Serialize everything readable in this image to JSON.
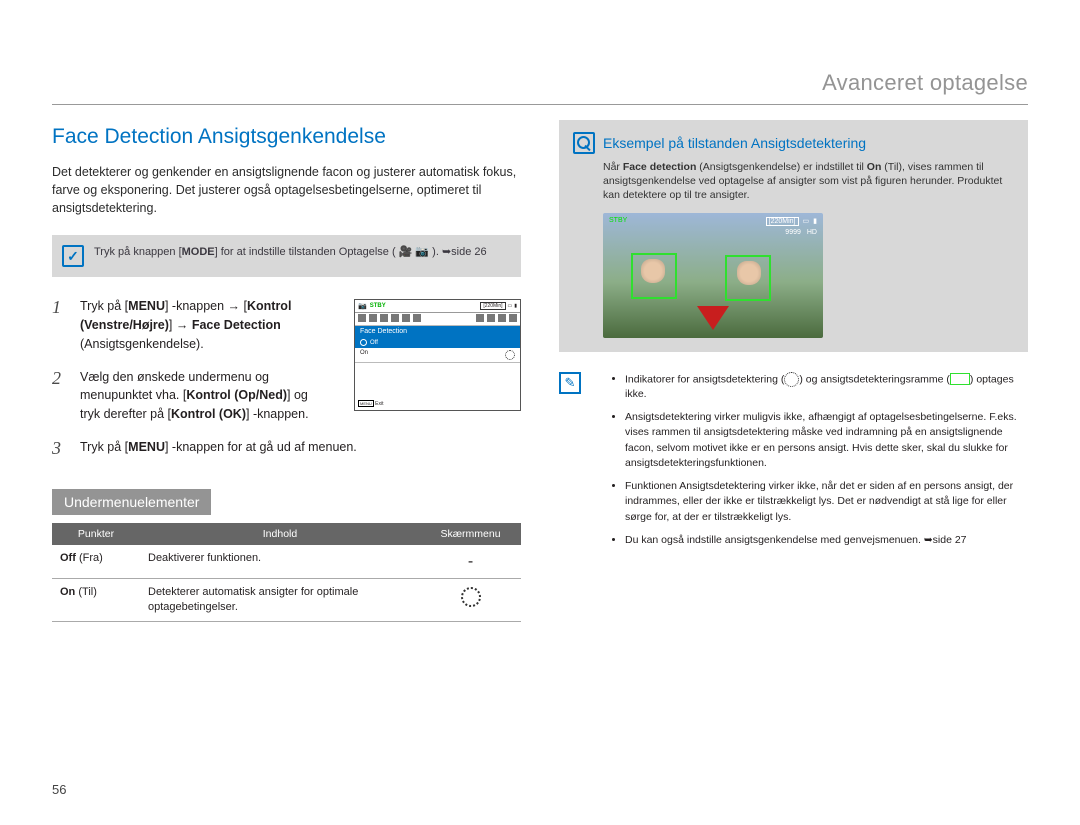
{
  "header": {
    "section": "Avanceret optagelse"
  },
  "title": "Face Detection Ansigtsgenkendelse",
  "intro": "Det detekterer og genkender en ansigtslignende facon og justerer automatisk fokus, farve og eksponering. Det justerer også optagelsesbetingelserne, optimeret til ansigtsdetektering.",
  "mode_callout": {
    "pre": "Tryk på knappen [",
    "mode": "MODE",
    "post": "] for at indstille tilstanden Optagelse ( 🎥 📷 ). ➥side 26"
  },
  "steps": {
    "s1a": "Tryk på [",
    "s1_menu": "MENU",
    "s1b": "] -knappen → [",
    "s1_kontrol": "Kontrol (Venstre/Højre)",
    "s1c": "] → ",
    "s1_face": "Face Detection",
    "s1d": " (Ansigtsgenkendelse).",
    "s2a": "Vælg den ønskede undermenu og menupunktet vha. [",
    "s2_kon": "Kontrol (Op/Ned)",
    "s2b": "] og tryk derefter på [",
    "s2_ok": "Kontrol (OK)",
    "s2c": "] -knappen.",
    "s3a": "Tryk på [",
    "s3_menu": "MENU",
    "s3b": "] -knappen for at gå ud af menuen."
  },
  "ui": {
    "stby": "STBY",
    "time": "[220Min]",
    "fd": "Face Detection",
    "off": "Off",
    "on": "On",
    "exit": "MENU Exit"
  },
  "subheader": "Undermenuelementer",
  "table": {
    "h1": "Punkter",
    "h2": "Indhold",
    "h3": "Skærmmenu",
    "r1a": "Off ",
    "r1a2": "(Fra)",
    "r1b": "Deaktiverer funktionen.",
    "r1c": "-",
    "r2a": "On ",
    "r2a2": "(Til)",
    "r2b": "Detekterer automatisk ansigter for optimale optagebetingelser."
  },
  "right": {
    "extitle": "Eksempel på tilstanden Ansigtsdetektering",
    "ex_pre": "Når ",
    "ex_bold1": "Face detection",
    "ex_mid": " (Ansigtsgenkendelse) er indstillet til ",
    "ex_bold2": "On",
    "ex_post": " (Til), vises rammen til ansigtsgenkendelse ved optagelse af ansigter som vist på figuren herunder. Produktet kan detektere op til tre ansigter.",
    "photo": {
      "stby": "STBY",
      "time": "[220Min]",
      "count": "9999",
      "hd": "HD"
    },
    "bul1a": "Indikatorer for ansigtsdetektering (",
    "bul1b": ") og ansigtsdetekteringsramme (",
    "bul1c": ") optages ikke.",
    "bul2": "Ansigtsdetektering virker muligvis ikke, afhængigt af optagelsesbetingelserne. F.eks. vises rammen til ansigtsdetektering måske ved indramning på en ansigtslignende facon, selvom motivet ikke er en persons ansigt. Hvis dette sker, skal du slukke for ansigtsdetekteringsfunktionen.",
    "bul3": "Funktionen Ansigtsdetektering virker ikke, når det er siden af en persons ansigt, der indrammes, eller der ikke er tilstrækkeligt lys. Det er nødvendigt at stå lige for eller sørge for, at der er tilstrækkeligt lys.",
    "bul4": "Du kan også indstille ansigtsgenkendelse med genvejsmenuen. ➥side 27"
  },
  "page_number": "56"
}
